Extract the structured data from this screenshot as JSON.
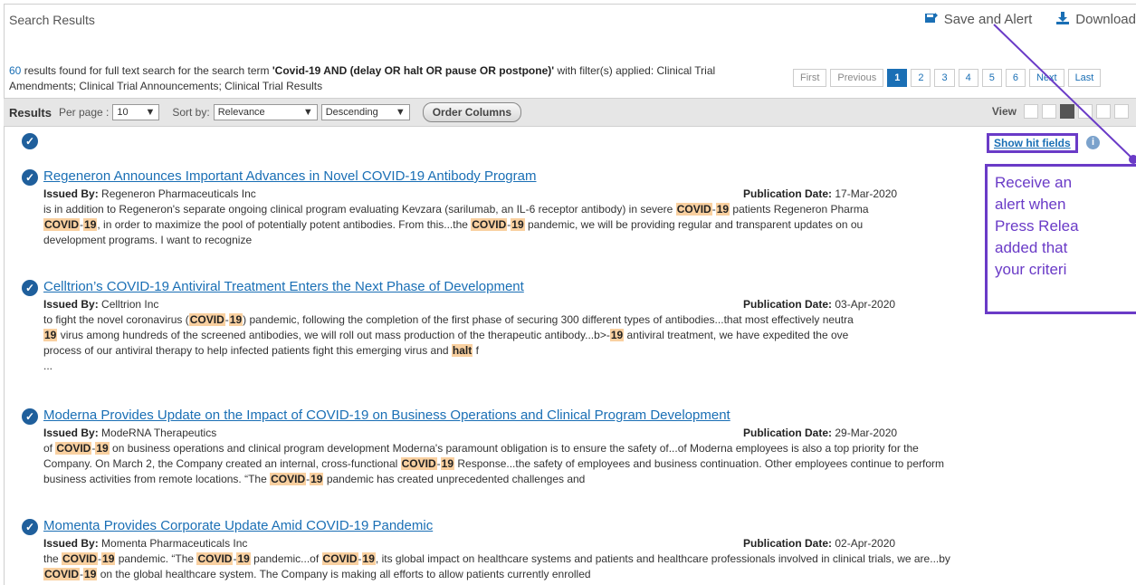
{
  "header": {
    "title": "Search Results",
    "save_alert_label": "Save and Alert",
    "download_label": "Download"
  },
  "summary": {
    "count": "60",
    "text_before_term": " results found for full text search for the search term ",
    "term": "'Covid-19 AND (delay OR halt OR pause OR postpone)'",
    "filter_text": " with filter(s) applied:  Clinical Trial Amendments; Clinical Trial Announcements; Clinical Trial Results"
  },
  "pager": {
    "first": "First",
    "previous": "Previous",
    "pages": [
      "1",
      "2",
      "3",
      "4",
      "5",
      "6"
    ],
    "active_page": "1",
    "next": "Next",
    "last": "Last"
  },
  "toolbar": {
    "results_label": "Results",
    "per_page_label": "Per page :",
    "per_page_value": "10",
    "sort_by_label": "Sort by:",
    "sort_by_value": "Relevance",
    "order_value": "Descending",
    "order_columns_label": "Order Columns",
    "view_label": "View"
  },
  "show_hit_fields_label": "Show hit fields",
  "info_icon_glyph": "i",
  "callout_lines": [
    "Receive an",
    "alert when",
    "Press Relea",
    "added that",
    "your criteri"
  ],
  "labels": {
    "issued_by": "Issued By:",
    "publication_date": "Publication Date:"
  },
  "results": [
    {
      "title": "Regeneron Announces Important Advances in Novel COVID-19 Antibody Program",
      "issuer": "Regeneron Pharmaceuticals Inc",
      "date": "17-Mar-2020",
      "snippet": [
        {
          "t": "is in addition to Regeneron's separate ongoing clinical program evaluating Kevzara (sarilumab, an IL-6 receptor antibody) in severe "
        },
        {
          "h": "COVID"
        },
        {
          "t": "-"
        },
        {
          "h": "19"
        },
        {
          "t": " patients Regeneron Pharma"
        },
        {
          "br": true
        },
        {
          "h": "COVID"
        },
        {
          "t": "-"
        },
        {
          "h": "19"
        },
        {
          "t": ", in order to maximize the pool of potentially potent antibodies. From this...the "
        },
        {
          "h": "COVID"
        },
        {
          "t": "-"
        },
        {
          "h": "19"
        },
        {
          "t": " pandemic, we will be providing regular and transparent updates on ou"
        },
        {
          "br": true
        },
        {
          "t": "development programs. I want to recognize"
        }
      ]
    },
    {
      "title": "Celltrion’s COVID-19 Antiviral Treatment Enters the Next Phase of Development",
      "issuer": "Celltrion Inc",
      "date": "03-Apr-2020",
      "snippet": [
        {
          "t": "to fight the novel coronavirus ("
        },
        {
          "h": "COVID"
        },
        {
          "t": "-"
        },
        {
          "h": "19"
        },
        {
          "t": ") pandemic, following the completion of the first phase of securing 300 different types of antibodies...that most effectively neutra"
        },
        {
          "br": true
        },
        {
          "h": "19"
        },
        {
          "t": " virus among hundreds of the screened antibodies, we will roll out mass production of the therapeutic antibody...b>-"
        },
        {
          "h": "19"
        },
        {
          "t": " antiviral treatment, we have expedited the ove"
        },
        {
          "br": true
        },
        {
          "t": "process of our antiviral therapy to help infected patients fight this emerging virus and "
        },
        {
          "h": "halt"
        },
        {
          "t": " f"
        },
        {
          "br": true
        },
        {
          "t": "..."
        }
      ]
    },
    {
      "title": "Moderna Provides Update on the Impact of COVID-19 on Business Operations and Clinical Program Development",
      "issuer": "ModeRNA Therapeutics",
      "date": "29-Mar-2020",
      "snippet": [
        {
          "t": "of "
        },
        {
          "h": "COVID"
        },
        {
          "t": "-"
        },
        {
          "h": "19"
        },
        {
          "t": " on business operations and clinical program development Moderna's paramount obligation is to ensure the safety of...of Moderna employees is also a top priority for the"
        },
        {
          "br": true
        },
        {
          "t": "Company. On March 2, the Company created an internal, cross-functional "
        },
        {
          "h": "COVID"
        },
        {
          "t": "-"
        },
        {
          "h": "19"
        },
        {
          "t": " Response...the safety of employees and business continuation. Other employees continue to perform"
        },
        {
          "br": true
        },
        {
          "t": "business activities from remote locations. “The "
        },
        {
          "h": "COVID"
        },
        {
          "t": "-"
        },
        {
          "h": "19"
        },
        {
          "t": " pandemic has created unprecedented challenges and"
        }
      ]
    },
    {
      "title": "Momenta Provides Corporate Update Amid COVID-19 Pandemic",
      "issuer": "Momenta Pharmaceuticals Inc",
      "date": "02-Apr-2020",
      "snippet": [
        {
          "t": "the "
        },
        {
          "h": "COVID"
        },
        {
          "t": "-"
        },
        {
          "h": "19"
        },
        {
          "t": " pandemic. “The "
        },
        {
          "h": "COVID"
        },
        {
          "t": "-"
        },
        {
          "h": "19"
        },
        {
          "t": " pandemic...of "
        },
        {
          "h": "COVID"
        },
        {
          "t": "-"
        },
        {
          "h": "19"
        },
        {
          "t": ", its global impact on healthcare systems and patients and healthcare professionals involved in clinical trials, we are...by"
        },
        {
          "br": true
        },
        {
          "h": "COVID"
        },
        {
          "t": "-"
        },
        {
          "h": "19"
        },
        {
          "t": " on the global healthcare system. The Company is making all efforts to allow patients currently enrolled"
        }
      ]
    }
  ],
  "colors": {
    "link": "#1a6fb5",
    "callout": "#6a3bc7",
    "highlight": "#f9d0a0",
    "check": "#1f5f9c"
  },
  "icons": {
    "check": "check-circle-icon",
    "save_alert": "save-alert-icon",
    "download": "download-icon",
    "info": "info-icon"
  }
}
